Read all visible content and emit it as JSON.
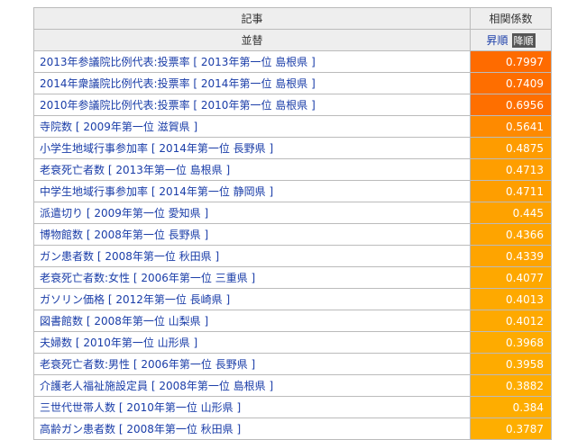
{
  "headers": {
    "col1_title": "記事",
    "col2_title": "相関係数",
    "sort_label": "並替",
    "sort_asc": "昇順",
    "sort_desc": "降順"
  },
  "rows": [
    {
      "label": "2013年参議院比例代表:投票率",
      "detail": "2013年第一位 島根県",
      "value": "0.7997",
      "color": "#fe6b00"
    },
    {
      "label": "2014年衆議院比例代表:投票率",
      "detail": "2014年第一位 島根県",
      "value": "0.7409",
      "color": "#fe6e00"
    },
    {
      "label": "2010年参議院比例代表:投票率",
      "detail": "2010年第一位 島根県",
      "value": "0.6956",
      "color": "#fe6f00"
    },
    {
      "label": "寺院数",
      "detail": "2009年第一位 滋賀県",
      "value": "0.5641",
      "color": "#fe8a00"
    },
    {
      "label": "小学生地域行事参加率",
      "detail": "2014年第一位 長野県",
      "value": "0.4875",
      "color": "#fe9c00"
    },
    {
      "label": "老衰死亡者数",
      "detail": "2013年第一位 島根県",
      "value": "0.4713",
      "color": "#fe9e00"
    },
    {
      "label": "中学生地域行事参加率",
      "detail": "2014年第一位 静岡県",
      "value": "0.4711",
      "color": "#fe9e00"
    },
    {
      "label": "派遣切り",
      "detail": "2009年第一位 愛知県",
      "value": "0.445",
      "color": "#fea200"
    },
    {
      "label": "博物館数",
      "detail": "2008年第一位 長野県",
      "value": "0.4366",
      "color": "#fea400"
    },
    {
      "label": "ガン患者数",
      "detail": "2008年第一位 秋田県",
      "value": "0.4339",
      "color": "#fea400"
    },
    {
      "label": "老衰死亡者数:女性",
      "detail": "2006年第一位 三重県",
      "value": "0.4077",
      "color": "#fea800"
    },
    {
      "label": "ガソリン価格",
      "detail": "2012年第一位 長崎県",
      "value": "0.4013",
      "color": "#fea900"
    },
    {
      "label": "図書館数",
      "detail": "2008年第一位 山梨県",
      "value": "0.4012",
      "color": "#fea900"
    },
    {
      "label": "夫婦数",
      "detail": "2010年第一位 山形県",
      "value": "0.3968",
      "color": "#feab00"
    },
    {
      "label": "老衰死亡者数:男性",
      "detail": "2006年第一位 長野県",
      "value": "0.3958",
      "color": "#feab00"
    },
    {
      "label": "介護老人福祉施設定員",
      "detail": "2008年第一位 島根県",
      "value": "0.3882",
      "color": "#feac00"
    },
    {
      "label": "三世代世帯人数",
      "detail": "2010年第一位 山形県",
      "value": "0.384",
      "color": "#fead00"
    },
    {
      "label": "高齢ガン患者数",
      "detail": "2008年第一位 秋田県",
      "value": "0.3787",
      "color": "#feae00"
    }
  ]
}
